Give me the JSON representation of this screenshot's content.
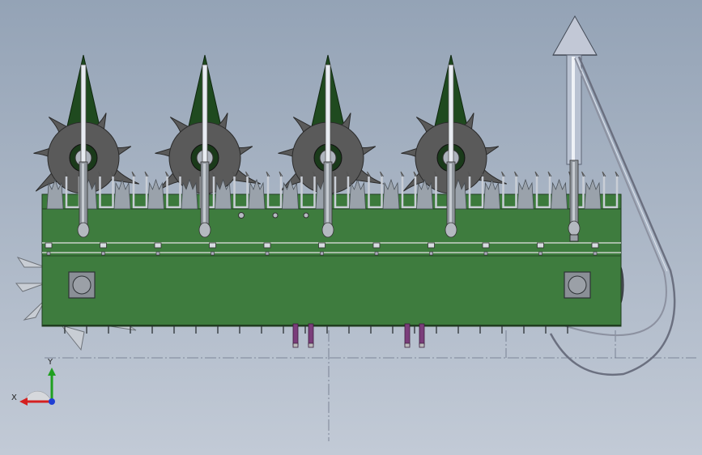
{
  "viewport": {
    "background_top": "#94a3b6",
    "background_bottom": "#c2cad6"
  },
  "model": {
    "frame_color": "#3c7a3c",
    "frame_dark": "#2a5a2a",
    "rotor_color": "#5a5a5a",
    "cone_color": "#1f4a1f",
    "pin_color": "#e8ecf2",
    "bracket_color": "#c9ced6",
    "actuator_color": "#7b3d7b",
    "divider_color": "#b9c2d2",
    "rotor_count": 4,
    "tine_count": 17,
    "bolt_count": 11
  },
  "triad": {
    "x_label": "X",
    "y_label": "Y",
    "x_color": "#d42020",
    "y_color": "#1fa01f",
    "z_color": "#1f3fd4"
  }
}
